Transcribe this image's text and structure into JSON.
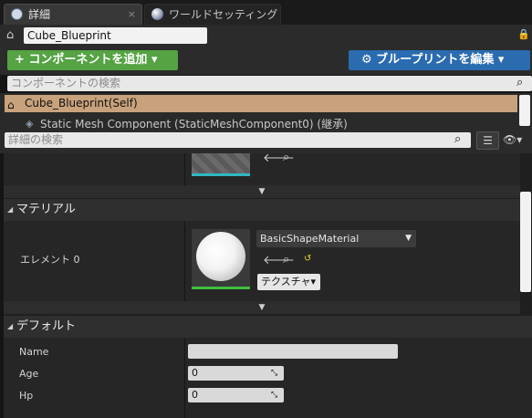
{
  "tabs": [
    {
      "label": "詳細",
      "close": "×",
      "icon": "details-icon"
    },
    {
      "label": "ワールドセッティング",
      "close": "×",
      "icon": "world-icon"
    }
  ],
  "object_name": "Cube_Blueprint",
  "toolbar": {
    "add_component_label": "+ コンポーネントを追加 ▾",
    "edit_blueprint_label": "⚙ ブループリントを編集 ▾"
  },
  "component_search": {
    "placeholder": "コンポーネントの検索"
  },
  "component_tree": {
    "self_label": "Cube_Blueprint(Self)",
    "static_mesh_label": "Static Mesh Component (StaticMeshComponent0) (継承)"
  },
  "detail_search": {
    "placeholder": "詳細の検索"
  },
  "material_section": {
    "title": "マテリアル",
    "element_label": "エレメント 0",
    "material_value": "BasicShapeMaterial",
    "texture_button": "テクスチャ▾"
  },
  "default_section": {
    "title": "デフォルト",
    "properties": [
      {
        "name": "Name",
        "value": ""
      },
      {
        "name": "Age",
        "value": "0"
      },
      {
        "name": "Hp",
        "value": "0"
      }
    ]
  },
  "colors": {
    "add_button": "#55a343",
    "edit_button": "#2b6bb0",
    "selected_component": "#c8a27c"
  }
}
